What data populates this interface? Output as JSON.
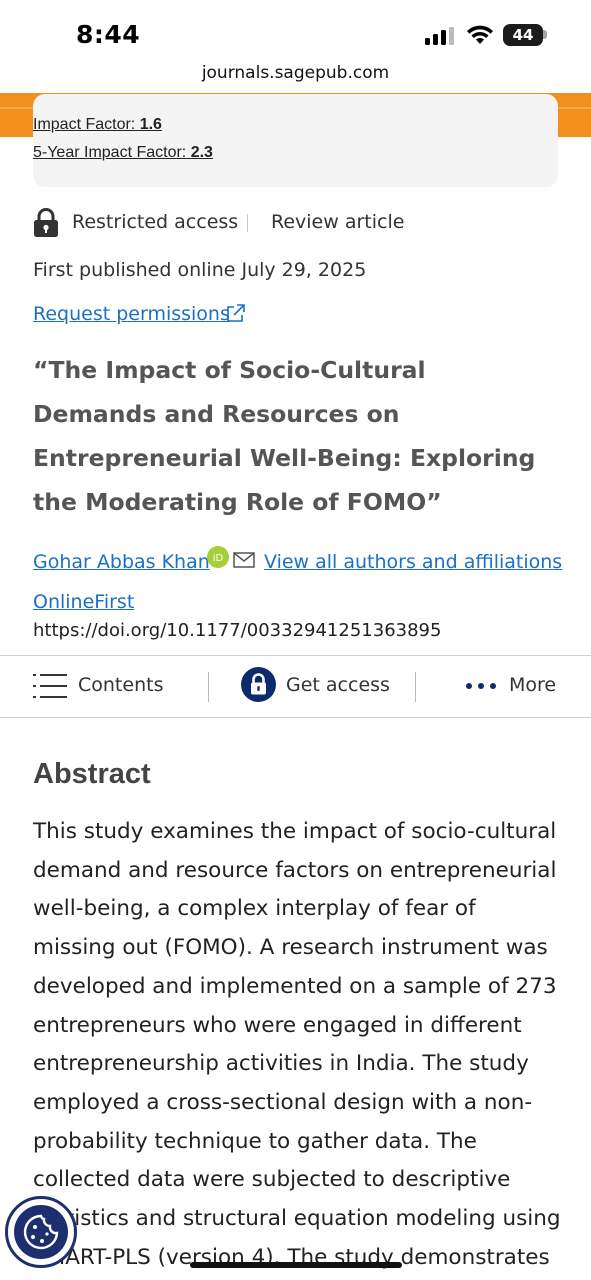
{
  "status_bar": {
    "time": "8:44",
    "battery": "44"
  },
  "browser": {
    "url": "journals.sagepub.com"
  },
  "journal": {
    "impact_factor_label": "Impact Factor:",
    "impact_factor_value": "1.6",
    "five_year_label": "5-Year Impact Factor:",
    "five_year_value": "2.3",
    "accent_color": "#f28e1c"
  },
  "article": {
    "access": "Restricted access",
    "type": "Review article",
    "published": "First published online July 29, 2025",
    "permissions": "Request permissions",
    "title": "“The Impact of Socio-Cultural Demands and Resources on Entrepreneurial Well-Being: Exploring the Moderating Role of FOMO”",
    "author": "Gohar Abbas Khan",
    "view_authors": "View all authors and affiliations",
    "online_first": "OnlineFirst",
    "doi": "https://doi.org/10.1177/00332941251363895",
    "link_color": "#1a6fc9"
  },
  "toolbar": {
    "contents": "Contents",
    "get_access": "Get access",
    "more": "More"
  },
  "abstract": {
    "heading": "Abstract",
    "body": "This study examines the impact of socio-cultural demand and resource factors on entrepreneurial well-being, a complex interplay of fear of missing out (FOMO). A research instrument was developed and implemented on a sample of 273 entrepreneurs who were engaged in different entrepreneurship activities in India. The study employed a cross-sectional design with a non-probability technique to gather data. The collected data were subjected to descriptive statistics and structural equation modeling using SMART-PLS (version 4). The study demonstrates the significant"
  },
  "icons": [
    "signal-icon",
    "wifi-icon",
    "battery-icon",
    "lock-icon",
    "external-link-icon",
    "orcid-icon",
    "mail-icon",
    "menu-icon",
    "padlock-icon",
    "more-dots-icon",
    "cookie-icon"
  ]
}
